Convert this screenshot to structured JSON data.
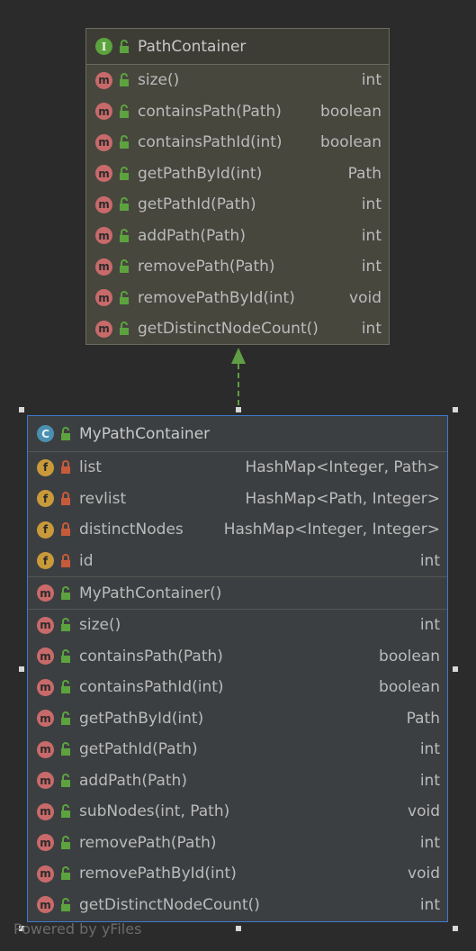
{
  "interface": {
    "name": "PathContainer",
    "badge": "I",
    "methods": [
      {
        "name": "size()",
        "type": "int"
      },
      {
        "name": "containsPath(Path)",
        "type": "boolean"
      },
      {
        "name": "containsPathId(int)",
        "type": "boolean"
      },
      {
        "name": "getPathById(int)",
        "type": "Path"
      },
      {
        "name": "getPathId(Path)",
        "type": "int"
      },
      {
        "name": "addPath(Path)",
        "type": "int"
      },
      {
        "name": "removePath(Path)",
        "type": "int"
      },
      {
        "name": "removePathById(int)",
        "type": "void"
      },
      {
        "name": "getDistinctNodeCount()",
        "type": "int"
      }
    ]
  },
  "class": {
    "name": "MyPathContainer",
    "badge": "C",
    "fields": [
      {
        "name": "list",
        "type": "HashMap<Integer, Path>"
      },
      {
        "name": "revlist",
        "type": "HashMap<Path, Integer>"
      },
      {
        "name": "distinctNodes",
        "type": "HashMap<Integer, Integer>"
      },
      {
        "name": "id",
        "type": "int"
      }
    ],
    "constructor": {
      "name": "MyPathContainer()",
      "type": ""
    },
    "methods": [
      {
        "name": "size()",
        "type": "int"
      },
      {
        "name": "containsPath(Path)",
        "type": "boolean"
      },
      {
        "name": "containsPathId(int)",
        "type": "boolean"
      },
      {
        "name": "getPathById(int)",
        "type": "Path"
      },
      {
        "name": "getPathId(Path)",
        "type": "int"
      },
      {
        "name": "addPath(Path)",
        "type": "int"
      },
      {
        "name": "subNodes(int, Path)",
        "type": "void"
      },
      {
        "name": "removePath(Path)",
        "type": "int"
      },
      {
        "name": "removePathById(int)",
        "type": "void"
      },
      {
        "name": "getDistinctNodeCount()",
        "type": "int"
      }
    ]
  },
  "icons": {
    "method": "m",
    "field": "f"
  },
  "colors": {
    "background": "#2b2b2b",
    "interface_bg": "#47473e",
    "class_bg": "#3c3f41",
    "selection_border": "#3e7ad0",
    "arrow": "#5f9e45",
    "unlock": "#5ca33f",
    "lock": "#c75a3a"
  },
  "footer": "Powered by yFiles"
}
